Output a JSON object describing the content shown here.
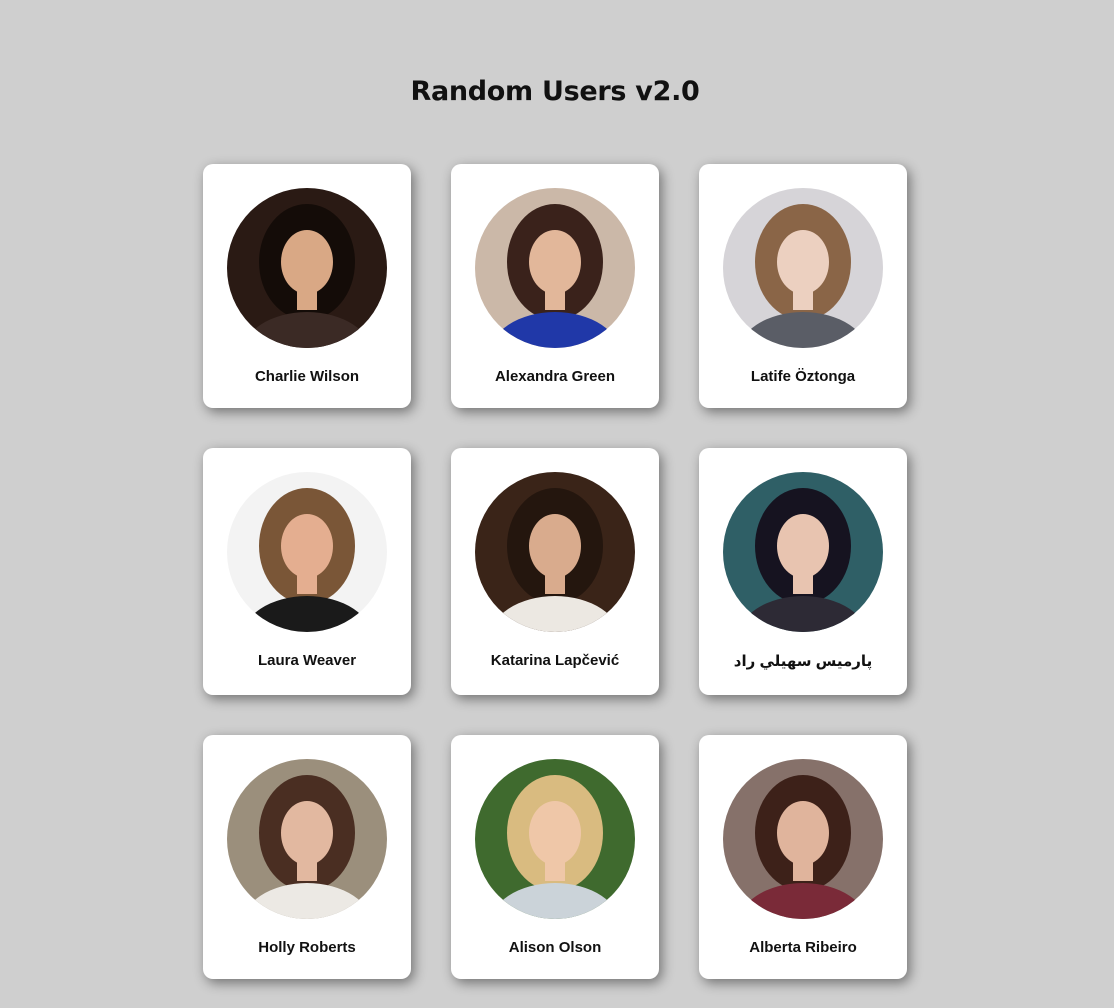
{
  "page": {
    "title": "Random Users v2.0"
  },
  "users": [
    {
      "name": "Charlie Wilson",
      "bg": "#2a1a14",
      "hair": "#140c08",
      "skin": "#d9a885",
      "shirt": "#3b2a25"
    },
    {
      "name": "Alexandra Green",
      "bg": "#cbb8a8",
      "hair": "#3a221b",
      "skin": "#e2b79a",
      "shirt": "#2038a8"
    },
    {
      "name": "Latife Öztonga",
      "bg": "#d6d4d8",
      "hair": "#8a6547",
      "skin": "#ecd0c0",
      "shirt": "#5a5d66"
    },
    {
      "name": "Laura Weaver",
      "bg": "#f3f3f3",
      "hair": "#7a5637",
      "skin": "#e4ae90",
      "shirt": "#1a1a1a"
    },
    {
      "name": "Katarina Lapčević",
      "bg": "#3a2418",
      "hair": "#24160e",
      "skin": "#d9ab8d",
      "shirt": "#ece8e2"
    },
    {
      "name": "پارمیس سهيلي راد",
      "bg": "#2f5f66",
      "hair": "#161320",
      "skin": "#e8c4b0",
      "shirt": "#2d2a35"
    },
    {
      "name": "Holly Roberts",
      "bg": "#9b8f7c",
      "hair": "#4a2e22",
      "skin": "#e2b8a0",
      "shirt": "#ece9e4"
    },
    {
      "name": "Alison Olson",
      "bg": "#3f6a2e",
      "hair": "#d9bb80",
      "skin": "#efc7a8",
      "shirt": "#cbd3d9"
    },
    {
      "name": "Alberta Ribeiro",
      "bg": "#86716a",
      "hair": "#3d2119",
      "skin": "#e0b49c",
      "shirt": "#7a2a38"
    }
  ]
}
